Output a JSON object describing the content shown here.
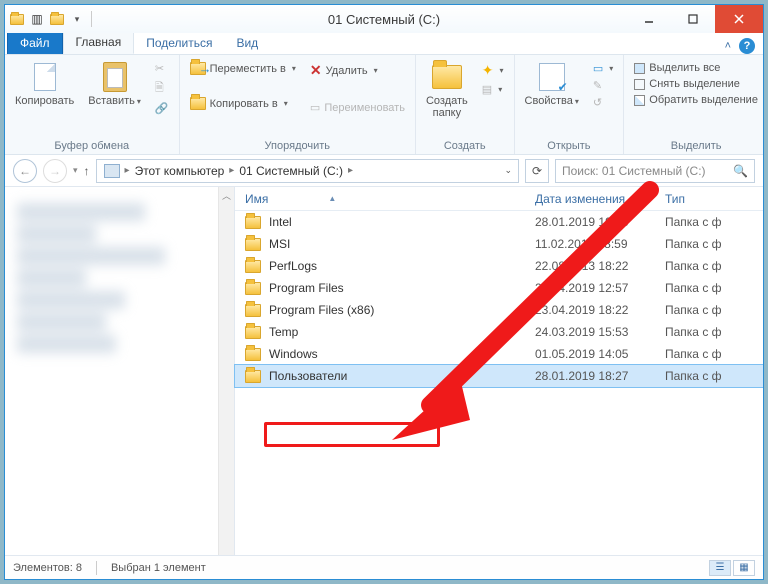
{
  "window": {
    "title": "01 Системный (C:)"
  },
  "tabs": {
    "file": "Файл",
    "home": "Главная",
    "share": "Поделиться",
    "view": "Вид"
  },
  "ribbon": {
    "clipboard": {
      "label": "Буфер обмена",
      "copy": "Копировать",
      "paste": "Вставить"
    },
    "organize": {
      "label": "Упорядочить",
      "moveTo": "Переместить в",
      "copyTo": "Копировать в",
      "delete": "Удалить",
      "rename": "Переименовать"
    },
    "new": {
      "label": "Создать",
      "newFolder": "Создать папку"
    },
    "open": {
      "label": "Открыть",
      "properties": "Свойства"
    },
    "select": {
      "label": "Выделить",
      "selectAll": "Выделить все",
      "selectNone": "Снять выделение",
      "invert": "Обратить выделение"
    }
  },
  "breadcrumb": {
    "pc": "Этот компьютер",
    "drive": "01 Системный (C:)"
  },
  "search": {
    "placeholder": "Поиск: 01 Системный (C:)"
  },
  "columns": {
    "name": "Имя",
    "date": "Дата изменения",
    "type": "Тип"
  },
  "rows": [
    {
      "name": "Intel",
      "date": "28.01.2019 19:28",
      "type": "Папка с ф"
    },
    {
      "name": "MSI",
      "date": "11.02.2019 18:59",
      "type": "Папка с ф"
    },
    {
      "name": "PerfLogs",
      "date": "22.08.2013 18:22",
      "type": "Папка с ф"
    },
    {
      "name": "Program Files",
      "date": "29.04.2019 12:57",
      "type": "Папка с ф"
    },
    {
      "name": "Program Files (x86)",
      "date": "23.04.2019 18:22",
      "type": "Папка с ф"
    },
    {
      "name": "Temp",
      "date": "24.03.2019 15:53",
      "type": "Папка с ф"
    },
    {
      "name": "Windows",
      "date": "01.05.2019 14:05",
      "type": "Папка с ф"
    },
    {
      "name": "Пользователи",
      "date": "28.01.2019 18:27",
      "type": "Папка с ф"
    }
  ],
  "status": {
    "count": "Элементов: 8",
    "selected": "Выбран 1 элемент"
  }
}
